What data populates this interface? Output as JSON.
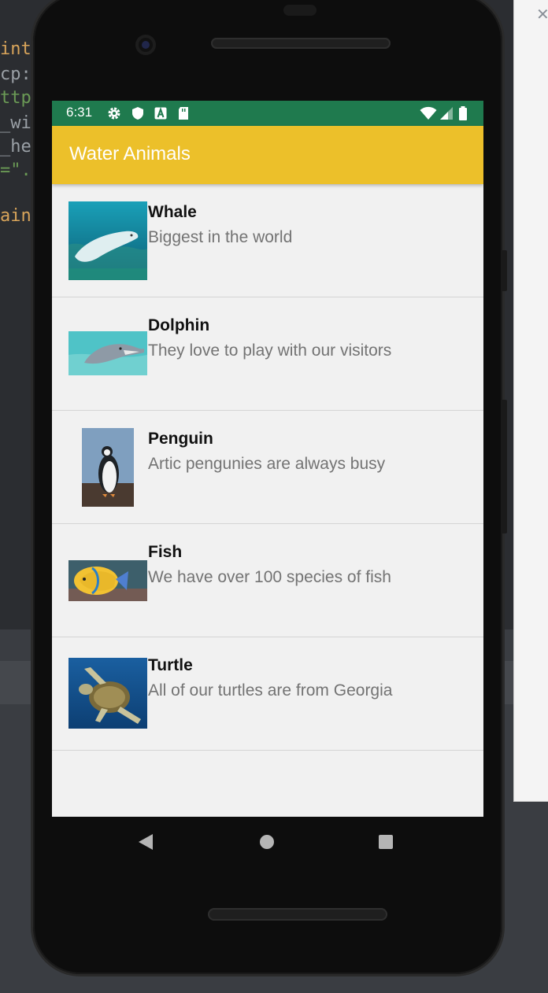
{
  "status_bar": {
    "time": "6:31",
    "icons": [
      "gear-icon",
      "shield-icon",
      "a-icon",
      "sd-card-icon",
      "wifi-icon",
      "signal-icon",
      "battery-icon"
    ]
  },
  "app_bar": {
    "title": "Water Animals"
  },
  "list": {
    "items": [
      {
        "title": "Whale",
        "subtitle": "Biggest in the world",
        "image": "whale-image"
      },
      {
        "title": "Dolphin",
        "subtitle": "They love to play with our visitors",
        "image": "dolphin-image"
      },
      {
        "title": "Penguin",
        "subtitle": "Artic pengunies are always busy",
        "image": "penguin-image"
      },
      {
        "title": "Fish",
        "subtitle": "We have over 100 species of fish",
        "image": "fish-image"
      },
      {
        "title": "Turtle",
        "subtitle": "All of our turtles are from Georgia",
        "image": "turtle-image"
      }
    ]
  },
  "navigation": {
    "icons": [
      "back-icon",
      "home-icon",
      "recents-icon"
    ]
  },
  "colors": {
    "status_bar": "#1f7a4e",
    "app_bar": "#ecc02a",
    "list_bg": "#f1f1f1"
  }
}
